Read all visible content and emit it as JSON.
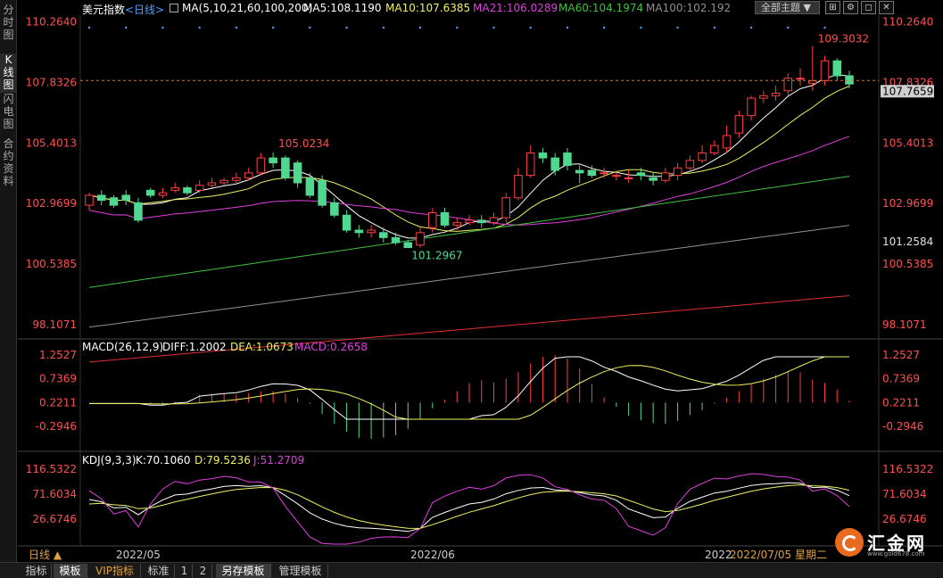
{
  "sidebar": {
    "tabs": [
      "分时图",
      "K线图",
      "闪电图",
      "合约资料"
    ]
  },
  "header": {
    "instrument": "美元指数",
    "period": "<日线>",
    "ma_label": "MA(5,10,21,60,100,200)",
    "ma5": "MA5:108.1190",
    "ma10": "MA10:107.6385",
    "ma21": "MA21:106.0289",
    "ma60": "MA60:104.1974",
    "ma100": "MA100:102.192",
    "theme_button": "全部主题",
    "icons": [
      "layout-icon",
      "settings-icon",
      "restore-icon",
      "close-icon"
    ]
  },
  "colors": {
    "up": "#ff4040",
    "down": "#50d890",
    "ma5": "#ffffff",
    "ma10": "#f0f060",
    "ma21": "#e040e0",
    "ma60": "#40c040",
    "ma100": "#909090",
    "ma200": "#e03030",
    "axis_text": "#ff5050",
    "current_price_box": "#c0c0c0"
  },
  "main_axis": {
    "left_ticks": [
      "110.2640",
      "107.8326",
      "105.4013",
      "102.9699",
      "100.5385",
      "98.1071"
    ],
    "right_ticks": [
      "110.2640",
      "107.8326",
      "105.4013",
      "102.9699",
      "100.5385",
      "98.1071"
    ],
    "current_price": "107.7659",
    "crosshair_price": "101.2584"
  },
  "annotations": {
    "high": "109.3032",
    "low": "101.2967",
    "local_high": "105.0234"
  },
  "macd": {
    "label": "MACD(26,12,9)",
    "diff": "DIFF:1.2002",
    "dea": "DEA:1.0673",
    "macd": "MACD:0.2658",
    "ticks": [
      "1.2527",
      "0.7369",
      "0.2211",
      "-0.2946"
    ]
  },
  "kdj": {
    "label": "KDJ(9,3,3)",
    "k": "K:70.1060",
    "d": "D:79.5236",
    "j": "J:51.2709",
    "ticks": [
      "116.5322",
      "71.6034",
      "26.6746"
    ]
  },
  "x_axis": {
    "period_button": "日线 ▲",
    "labels": [
      "2022/05",
      "2022/06",
      "2022"
    ],
    "date_readout": "2022/07/05 星期二"
  },
  "bottom_tabs": [
    "指标",
    "模板",
    "VIP指标",
    "标准",
    "1",
    "2",
    "另存模板",
    "管理模板"
  ],
  "logo": {
    "name": "汇金网",
    "url": "www.gold678.com"
  },
  "chart_data": {
    "type": "candlestick",
    "dates": [
      "2022-04-22",
      "2022-04-25",
      "2022-04-26",
      "2022-04-27",
      "2022-04-28",
      "2022-04-29",
      "2022-05-02",
      "2022-05-03",
      "2022-05-04",
      "2022-05-05",
      "2022-05-06",
      "2022-05-09",
      "2022-05-10",
      "2022-05-11",
      "2022-05-12",
      "2022-05-13",
      "2022-05-16",
      "2022-05-17",
      "2022-05-18",
      "2022-05-19",
      "2022-05-20",
      "2022-05-23",
      "2022-05-24",
      "2022-05-25",
      "2022-05-26",
      "2022-05-27",
      "2022-05-30",
      "2022-05-31",
      "2022-06-01",
      "2022-06-02",
      "2022-06-03",
      "2022-06-06",
      "2022-06-07",
      "2022-06-08",
      "2022-06-09",
      "2022-06-10",
      "2022-06-13",
      "2022-06-14",
      "2022-06-15",
      "2022-06-16",
      "2022-06-17",
      "2022-06-20",
      "2022-06-21",
      "2022-06-22",
      "2022-06-23",
      "2022-06-24",
      "2022-06-27",
      "2022-06-28",
      "2022-06-29",
      "2022-06-30",
      "2022-07-01",
      "2022-07-04",
      "2022-07-05",
      "2022-07-06",
      "2022-07-07",
      "2022-07-08",
      "2022-07-11",
      "2022-07-12",
      "2022-07-13",
      "2022-07-14",
      "2022-07-15",
      "2022-07-18",
      "2022-07-19"
    ],
    "open": [
      102.9,
      103.3,
      103.2,
      103.3,
      103.0,
      103.5,
      103.3,
      103.5,
      103.6,
      103.5,
      103.7,
      103.8,
      103.9,
      104.0,
      104.2,
      104.8,
      104.8,
      104.6,
      104.0,
      103.9,
      103.0,
      102.5,
      101.9,
      101.8,
      101.8,
      101.6,
      101.4,
      101.3,
      102.0,
      102.6,
      102.1,
      102.2,
      102.3,
      102.2,
      102.4,
      103.2,
      104.1,
      105.0,
      104.8,
      105.0,
      104.3,
      104.3,
      104.2,
      104.1,
      104.0,
      104.2,
      104.0,
      103.9,
      104.1,
      104.4,
      104.7,
      105.0,
      105.2,
      105.8,
      106.5,
      107.2,
      107.3,
      107.5,
      108.0,
      107.8,
      107.9,
      108.7,
      108.1
    ],
    "close": [
      103.3,
      103.1,
      102.9,
      103.1,
      102.3,
      103.3,
      103.4,
      103.6,
      103.4,
      103.7,
      103.8,
      103.9,
      104.0,
      104.2,
      104.8,
      104.6,
      104.0,
      103.8,
      103.3,
      102.9,
      102.5,
      101.9,
      101.8,
      101.9,
      101.6,
      101.4,
      101.2,
      101.8,
      102.6,
      102.1,
      102.2,
      102.3,
      102.2,
      102.4,
      103.2,
      104.1,
      105.0,
      104.8,
      104.3,
      104.5,
      104.2,
      104.1,
      104.2,
      104.1,
      104.0,
      104.1,
      103.9,
      104.2,
      104.4,
      104.7,
      105.0,
      105.3,
      105.7,
      106.5,
      107.2,
      107.3,
      107.4,
      108.0,
      108.0,
      107.9,
      108.7,
      108.1,
      107.77
    ],
    "high": [
      103.4,
      103.5,
      103.3,
      103.5,
      103.2,
      103.6,
      103.6,
      103.8,
      103.7,
      103.9,
      104.0,
      104.0,
      104.2,
      104.4,
      105.0,
      105.02,
      104.9,
      104.7,
      104.2,
      104.1,
      103.2,
      102.7,
      102.1,
      102.1,
      102.0,
      101.8,
      101.5,
      102.0,
      102.8,
      102.8,
      102.4,
      102.5,
      102.5,
      102.6,
      103.4,
      104.4,
      105.3,
      105.2,
      105.0,
      105.2,
      104.5,
      104.5,
      104.4,
      104.3,
      104.3,
      104.4,
      104.2,
      104.4,
      104.6,
      104.9,
      105.3,
      105.5,
      106.1,
      106.7,
      107.3,
      107.5,
      107.7,
      108.2,
      108.4,
      109.3,
      108.9,
      108.8,
      108.3
    ],
    "low": [
      102.7,
      102.9,
      102.8,
      102.9,
      102.2,
      103.2,
      103.2,
      103.4,
      103.3,
      103.4,
      103.6,
      103.7,
      103.8,
      103.9,
      104.1,
      104.4,
      103.9,
      103.6,
      103.2,
      102.8,
      102.4,
      101.8,
      101.6,
      101.6,
      101.4,
      101.3,
      101.2,
      101.2,
      101.8,
      102.0,
      101.9,
      102.1,
      102.0,
      102.1,
      102.2,
      103.1,
      104.0,
      104.6,
      104.1,
      104.3,
      103.8,
      104.0,
      104.0,
      103.9,
      103.8,
      103.9,
      103.7,
      103.8,
      103.9,
      104.3,
      104.6,
      104.9,
      105.0,
      105.6,
      106.3,
      107.0,
      107.1,
      107.3,
      107.7,
      107.5,
      107.7,
      107.9,
      107.6
    ],
    "ma_lines": {
      "MA5": "108.1190",
      "MA10": "107.6385",
      "MA21": "106.0289",
      "MA60": "104.1974",
      "MA100": "102.192"
    },
    "y_range": [
      97.6,
      110.5
    ],
    "macd": {
      "diff": 1.2002,
      "dea": 1.0673,
      "macd": 0.2658
    },
    "kdj": {
      "k": 70.106,
      "d": 79.5236,
      "j": 51.2709
    }
  }
}
